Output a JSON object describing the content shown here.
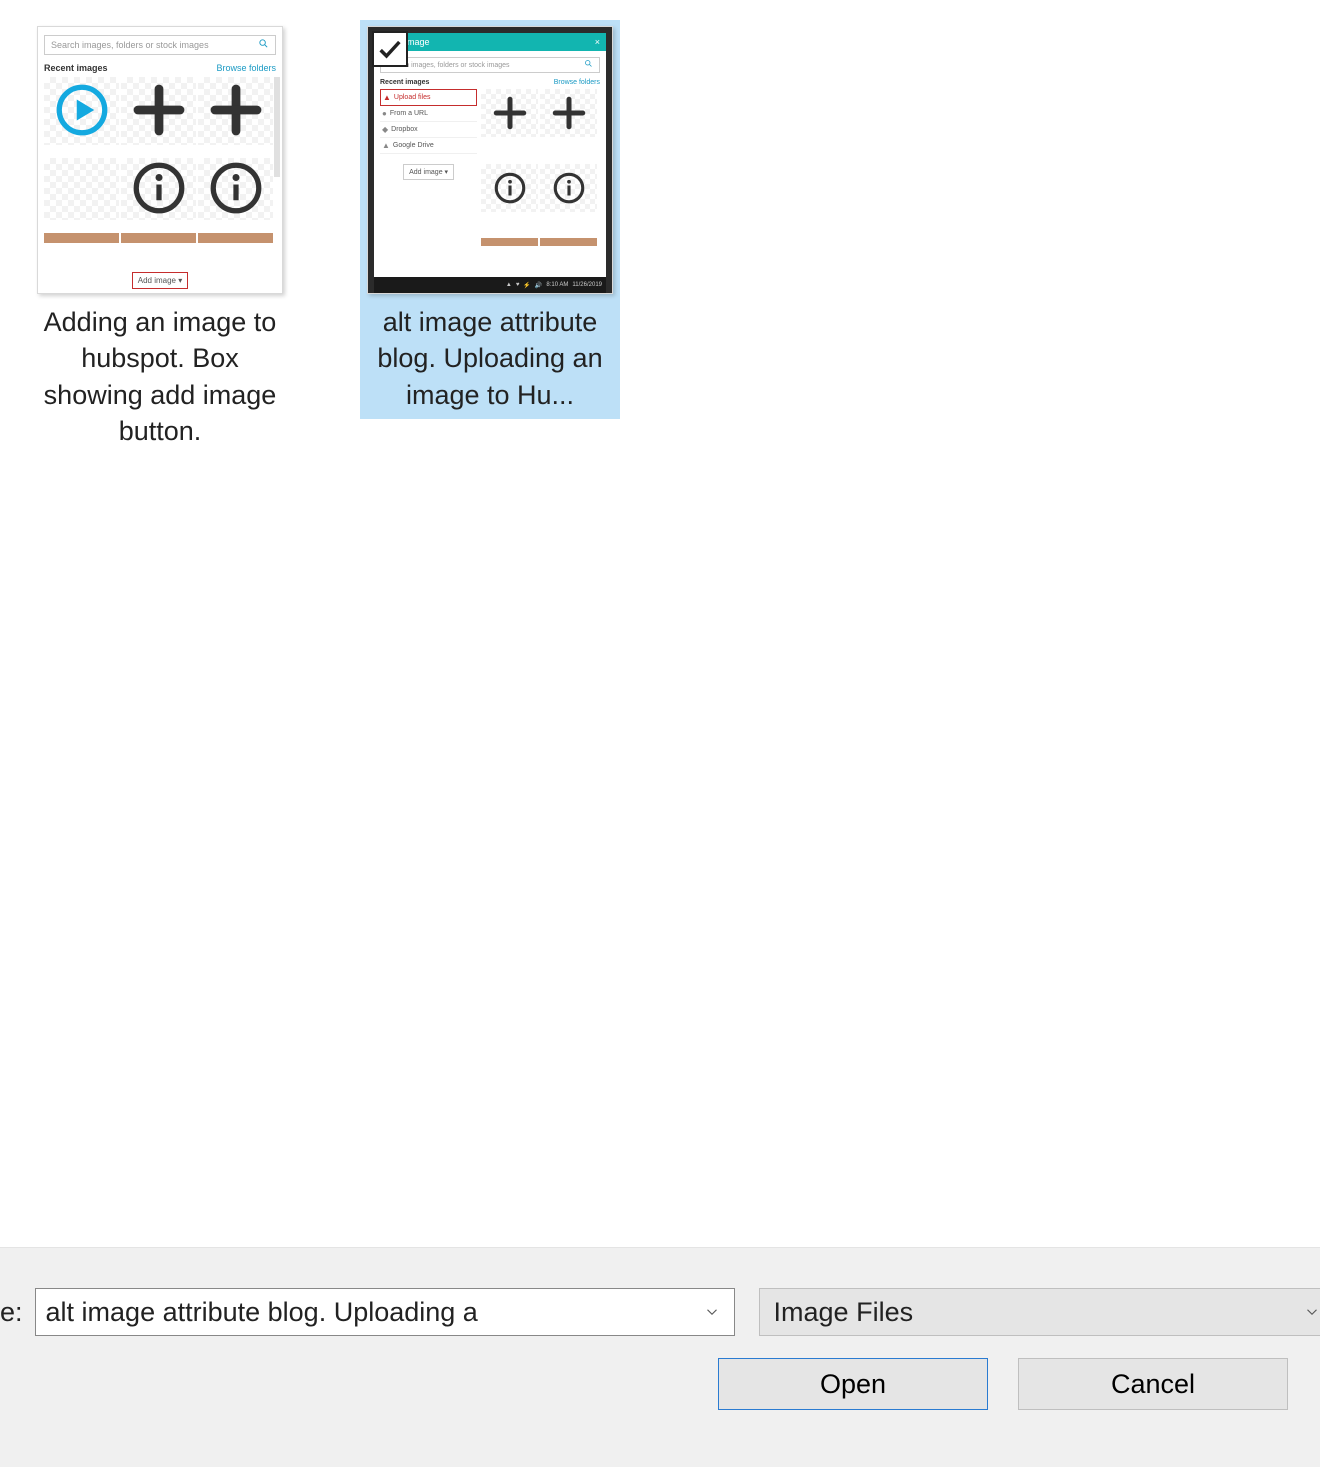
{
  "files": [
    {
      "caption": "Adding an image to hubspot. Box showing add image button.",
      "selected": false,
      "mock": {
        "search_placeholder": "Search images, folders or stock images",
        "recent_label": "Recent images",
        "browse_label": "Browse folders",
        "add_image_label": "Add image ▾"
      }
    },
    {
      "caption": "alt image attribute blog. Uploading an image to Hu...",
      "selected": true,
      "mock": {
        "title": "Insert image",
        "close": "×",
        "search_placeholder": "Search images, folders or stock images",
        "recent_label": "Recent images",
        "browse_label": "Browse folders",
        "menu": [
          "Upload files",
          "From a URL",
          "Dropbox",
          "Google Drive"
        ],
        "add_image_label": "Add image ▾",
        "task_time": "8:10 AM",
        "task_date": "11/26/2019"
      }
    }
  ],
  "bottom": {
    "label_suffix": "e:",
    "filename_value": "alt image attribute blog. Uploading a",
    "filter_value": "Image Files",
    "open_label": "Open",
    "cancel_label": "Cancel"
  }
}
